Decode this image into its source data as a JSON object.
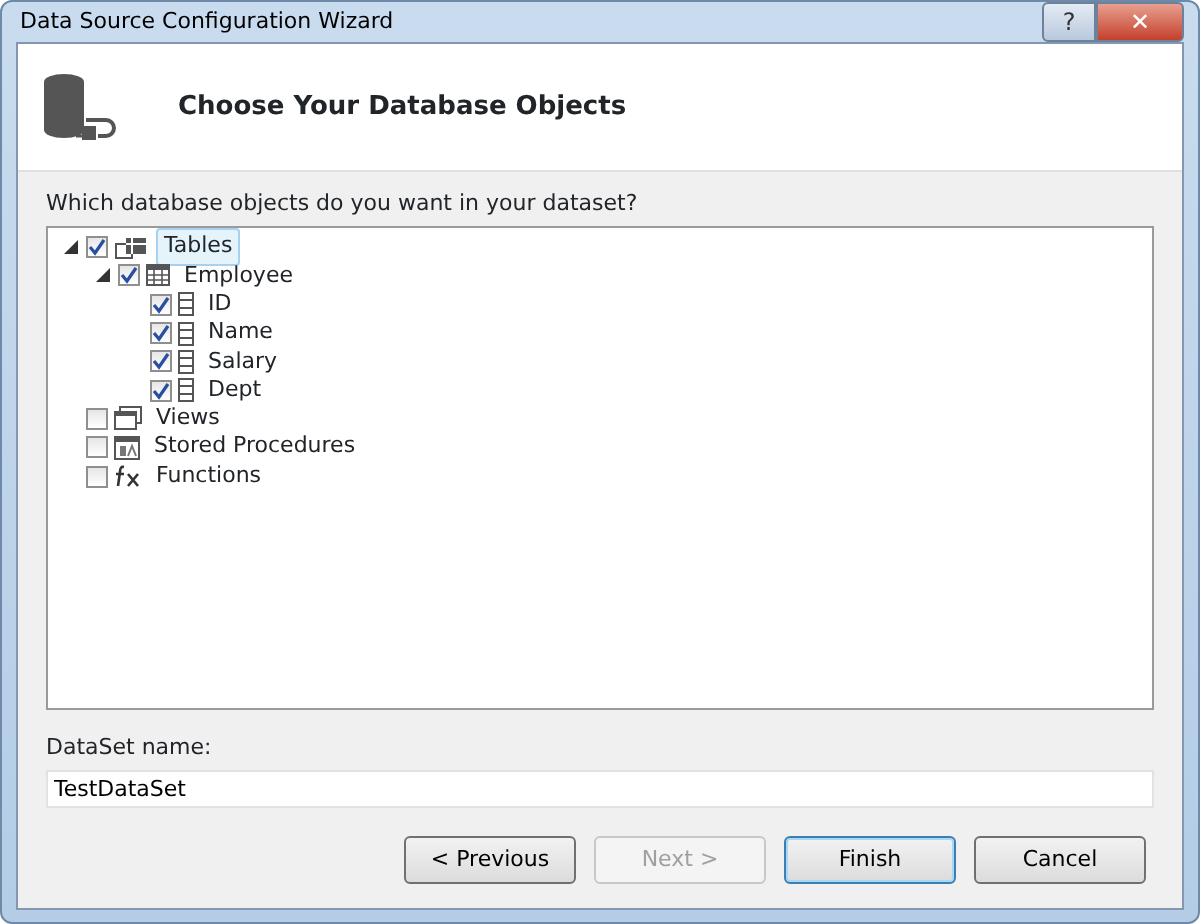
{
  "window": {
    "title": "Data Source Configuration Wizard",
    "buttons": [
      {
        "kind": "help",
        "label": "?"
      },
      {
        "kind": "close",
        "label": "✕"
      }
    ]
  },
  "header": {
    "title": "Choose Your Database Objects"
  },
  "tree": {
    "label": "Which database objects do you want in your dataset?",
    "items": [
      {
        "label": "Tables",
        "kind": "tables",
        "checked": true,
        "expanded": true,
        "selected": true,
        "children": [
          {
            "label": "Employee",
            "kind": "table",
            "checked": true,
            "expanded": true,
            "selected": false,
            "children": [
              {
                "label": "ID",
                "kind": "column",
                "checked": true,
                "selected": false
              },
              {
                "label": "Name",
                "kind": "column",
                "checked": true,
                "selected": false
              },
              {
                "label": "Salary",
                "kind": "column",
                "checked": true,
                "selected": false
              },
              {
                "label": "Dept",
                "kind": "column",
                "checked": true,
                "selected": false
              }
            ]
          }
        ]
      },
      {
        "label": "Views",
        "kind": "views",
        "checked": false,
        "selected": false
      },
      {
        "label": "Stored Procedures",
        "kind": "procedures",
        "checked": false,
        "selected": false
      },
      {
        "label": "Functions",
        "kind": "functions",
        "checked": false,
        "selected": false
      }
    ]
  },
  "dataset_name": {
    "label": "DataSet name:",
    "value": "TestDataSet"
  },
  "buttons": [
    {
      "label": "< Previous",
      "disabled": false,
      "default": false
    },
    {
      "label": "Next >",
      "disabled": true,
      "default": false
    },
    {
      "label": "Finish",
      "disabled": false,
      "default": true
    },
    {
      "label": "Cancel",
      "disabled": false,
      "default": false
    }
  ]
}
